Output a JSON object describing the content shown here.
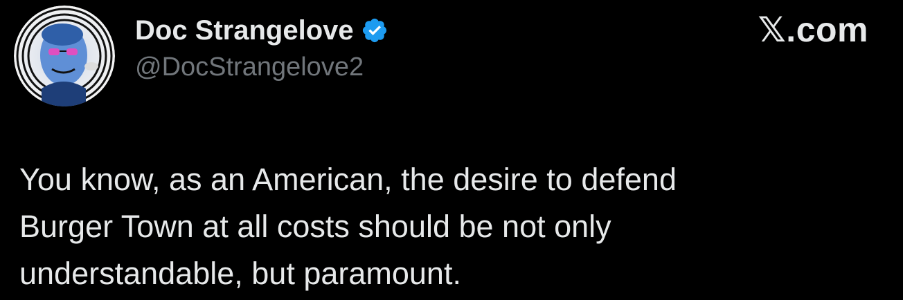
{
  "header": {
    "display_name": "Doc Strangelove",
    "handle": "@DocStrangelove2",
    "verified": true,
    "watermark": "𝕏.com",
    "avatar_icon": "stylized-portrait-avatar"
  },
  "tweet": {
    "lines": [
      "You know, as an American, the desire to defend",
      "Burger Town at all costs should be not only",
      "understandable, but paramount."
    ]
  },
  "colors": {
    "background": "#000000",
    "primary_text": "#e7e9ea",
    "secondary_text": "#71767b",
    "verified_blue": "#1d9bf0"
  }
}
